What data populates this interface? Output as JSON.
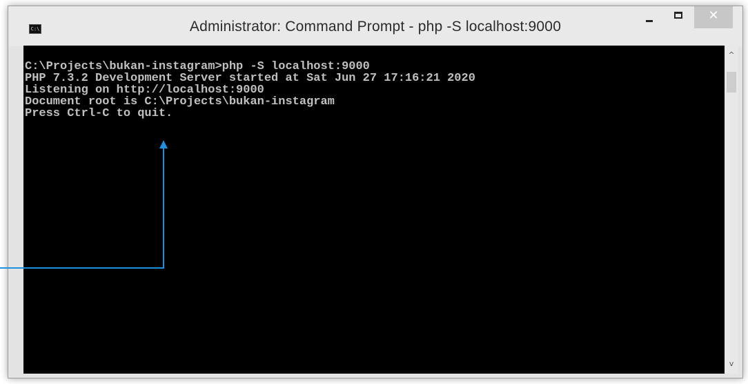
{
  "window": {
    "title": "Administrator: Command Prompt - php  -S localhost:9000",
    "icon": "cmd-icon",
    "controls": {
      "minimize": "minimize-icon",
      "maximize": "maximize-icon",
      "close_glyph": "✕"
    }
  },
  "console": {
    "lines": [
      "C:\\Projects\\bukan-instagram>php -S localhost:9000",
      "PHP 7.3.2 Development Server started at Sat Jun 27 17:16:21 2020",
      "Listening on http://localhost:9000",
      "Document root is C:\\Projects\\bukan-instagram",
      "Press Ctrl-C to quit."
    ]
  },
  "scrollbar": {
    "up_glyph": "^",
    "down_glyph": "v"
  },
  "colors": {
    "console_background": "#000000",
    "console_text": "#c0c0c0",
    "annotation_arrow": "#1e90e0",
    "close_button": "#c7c7c7"
  }
}
